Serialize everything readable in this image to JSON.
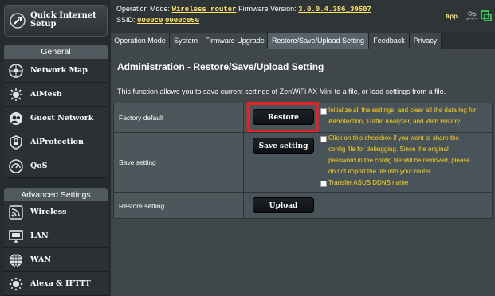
{
  "header": {
    "op_mode_label": "Operation Mode:",
    "op_mode_value": "Wireless router",
    "fw_label": "Firmware Version:",
    "fw_value": "3.0.0.4.386_39507",
    "ssid_label": "SSID:",
    "ssid_1": "0000c0",
    "ssid_2": "0000c05G",
    "app_label": "App"
  },
  "sidebar": {
    "quick_setup": "Quick Internet Setup",
    "general_header": "General",
    "general_items": [
      {
        "label": "Network Map",
        "icon": "network-map-icon"
      },
      {
        "label": "AiMesh",
        "icon": "aimesh-icon"
      },
      {
        "label": "Guest Network",
        "icon": "guest-network-icon"
      },
      {
        "label": "AiProtection",
        "icon": "aiprotection-icon"
      },
      {
        "label": "QoS",
        "icon": "qos-icon"
      }
    ],
    "advanced_header": "Advanced Settings",
    "advanced_items": [
      {
        "label": "Wireless",
        "icon": "wireless-icon"
      },
      {
        "label": "LAN",
        "icon": "lan-icon"
      },
      {
        "label": "WAN",
        "icon": "wan-icon"
      },
      {
        "label": "Alexa & IFTTT",
        "icon": "alexa-icon"
      }
    ]
  },
  "tabs": [
    "Operation Mode",
    "System",
    "Firmware Upgrade",
    "Restore/Save/Upload Setting",
    "Feedback",
    "Privacy"
  ],
  "active_tab": 3,
  "page": {
    "title": "Administration - Restore/Save/Upload Setting",
    "description": "This function allows you to save current settings of ZenWiFi AX Mini to a file, or load settings from a file."
  },
  "rows": {
    "factory": {
      "label": "Factory default",
      "button": "Restore",
      "note_lines": [
        "Initialize all the settings, and clear all the data log for",
        "AiProtection, Traffic Analyzer, and Web History."
      ]
    },
    "save": {
      "label": "Save setting",
      "button": "Save setting",
      "note_lines": [
        "Click on this checkbox if you want to share the",
        "config file for debugging. Since the original",
        "password in the config file will be removed, please",
        "do not import the file into your router"
      ],
      "ddns": "Transfer ASUS DDNS name"
    },
    "restore": {
      "label": "Restore setting",
      "button": "Upload"
    }
  },
  "colors": {
    "accent_yellow": "#ffd21a",
    "highlight_red": "#e02424"
  }
}
